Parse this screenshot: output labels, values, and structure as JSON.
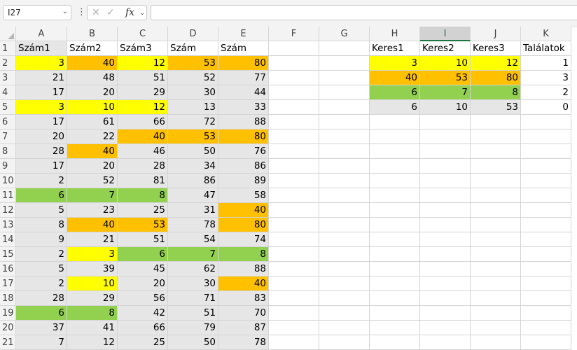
{
  "namebox": {
    "value": "I27",
    "dropdown_icon": "chevron-down-icon"
  },
  "formula_bar": {
    "more_icon": "vertical-dots-icon",
    "cancel_icon": "x-icon",
    "enter_icon": "check-icon",
    "fx_label": "fx",
    "fx_dropdown_icon": "chevron-down-icon",
    "value": ""
  },
  "active_column": "I",
  "colors": {
    "yellow": "#ffff00",
    "orange": "#ffc000",
    "green": "#92d050",
    "gray": "#e7e6e6",
    "white": "#ffffff"
  },
  "columns": [
    "A",
    "B",
    "C",
    "D",
    "E",
    "F",
    "G",
    "H",
    "I",
    "J",
    "K"
  ],
  "rows": [
    {
      "num": "1",
      "cells": [
        {
          "v": "Szám1",
          "f": "gray",
          "t": "txt"
        },
        {
          "v": "Szám2",
          "f": "white",
          "t": "txt"
        },
        {
          "v": "Szám3",
          "f": "white",
          "t": "txt"
        },
        {
          "v": "Szám",
          "f": "white",
          "t": "txt"
        },
        {
          "v": "Szám",
          "f": "white",
          "t": "txt"
        },
        {
          "v": "",
          "f": "white"
        },
        {
          "v": "",
          "f": "white"
        },
        {
          "v": "Keres1",
          "f": "white",
          "t": "txt"
        },
        {
          "v": "Keres2",
          "f": "white",
          "t": "txt"
        },
        {
          "v": "Keres3",
          "f": "white",
          "t": "txt"
        },
        {
          "v": "Találatok",
          "f": "white",
          "t": "txt"
        }
      ]
    },
    {
      "num": "2",
      "cells": [
        {
          "v": "3",
          "f": "yellow"
        },
        {
          "v": "40",
          "f": "orange"
        },
        {
          "v": "12",
          "f": "yellow"
        },
        {
          "v": "53",
          "f": "orange"
        },
        {
          "v": "80",
          "f": "orange"
        },
        {
          "v": "",
          "f": "white"
        },
        {
          "v": "",
          "f": "white"
        },
        {
          "v": "3",
          "f": "yellow"
        },
        {
          "v": "10",
          "f": "yellow"
        },
        {
          "v": "12",
          "f": "yellow"
        },
        {
          "v": "1",
          "f": "white"
        }
      ]
    },
    {
      "num": "3",
      "cells": [
        {
          "v": "21",
          "f": "gray"
        },
        {
          "v": "48",
          "f": "gray"
        },
        {
          "v": "51",
          "f": "gray"
        },
        {
          "v": "52",
          "f": "gray"
        },
        {
          "v": "77",
          "f": "gray"
        },
        {
          "v": "",
          "f": "white"
        },
        {
          "v": "",
          "f": "white"
        },
        {
          "v": "40",
          "f": "orange"
        },
        {
          "v": "53",
          "f": "orange"
        },
        {
          "v": "80",
          "f": "orange"
        },
        {
          "v": "3",
          "f": "white"
        }
      ]
    },
    {
      "num": "4",
      "cells": [
        {
          "v": "17",
          "f": "gray"
        },
        {
          "v": "20",
          "f": "gray"
        },
        {
          "v": "29",
          "f": "gray"
        },
        {
          "v": "30",
          "f": "gray"
        },
        {
          "v": "44",
          "f": "gray"
        },
        {
          "v": "",
          "f": "white"
        },
        {
          "v": "",
          "f": "white"
        },
        {
          "v": "6",
          "f": "green"
        },
        {
          "v": "7",
          "f": "green"
        },
        {
          "v": "8",
          "f": "green"
        },
        {
          "v": "2",
          "f": "white"
        }
      ]
    },
    {
      "num": "5",
      "cells": [
        {
          "v": "3",
          "f": "yellow"
        },
        {
          "v": "10",
          "f": "yellow"
        },
        {
          "v": "12",
          "f": "yellow"
        },
        {
          "v": "13",
          "f": "gray"
        },
        {
          "v": "33",
          "f": "gray"
        },
        {
          "v": "",
          "f": "white"
        },
        {
          "v": "",
          "f": "white"
        },
        {
          "v": "6",
          "f": "gray"
        },
        {
          "v": "10",
          "f": "gray"
        },
        {
          "v": "53",
          "f": "gray"
        },
        {
          "v": "0",
          "f": "white"
        }
      ]
    },
    {
      "num": "6",
      "cells": [
        {
          "v": "17",
          "f": "gray"
        },
        {
          "v": "61",
          "f": "gray"
        },
        {
          "v": "66",
          "f": "gray"
        },
        {
          "v": "72",
          "f": "gray"
        },
        {
          "v": "88",
          "f": "gray"
        }
      ]
    },
    {
      "num": "7",
      "cells": [
        {
          "v": "20",
          "f": "gray"
        },
        {
          "v": "22",
          "f": "gray"
        },
        {
          "v": "40",
          "f": "orange"
        },
        {
          "v": "53",
          "f": "orange"
        },
        {
          "v": "80",
          "f": "orange"
        }
      ]
    },
    {
      "num": "8",
      "cells": [
        {
          "v": "28",
          "f": "gray"
        },
        {
          "v": "40",
          "f": "orange"
        },
        {
          "v": "46",
          "f": "gray"
        },
        {
          "v": "50",
          "f": "gray"
        },
        {
          "v": "76",
          "f": "gray"
        }
      ]
    },
    {
      "num": "9",
      "cells": [
        {
          "v": "17",
          "f": "gray"
        },
        {
          "v": "20",
          "f": "gray"
        },
        {
          "v": "28",
          "f": "gray"
        },
        {
          "v": "34",
          "f": "gray"
        },
        {
          "v": "86",
          "f": "gray"
        }
      ]
    },
    {
      "num": "10",
      "cells": [
        {
          "v": "2",
          "f": "gray"
        },
        {
          "v": "52",
          "f": "gray"
        },
        {
          "v": "81",
          "f": "gray"
        },
        {
          "v": "86",
          "f": "gray"
        },
        {
          "v": "89",
          "f": "gray"
        }
      ]
    },
    {
      "num": "11",
      "cells": [
        {
          "v": "6",
          "f": "green"
        },
        {
          "v": "7",
          "f": "green"
        },
        {
          "v": "8",
          "f": "green"
        },
        {
          "v": "47",
          "f": "gray"
        },
        {
          "v": "58",
          "f": "gray"
        }
      ]
    },
    {
      "num": "12",
      "cells": [
        {
          "v": "5",
          "f": "gray"
        },
        {
          "v": "23",
          "f": "gray"
        },
        {
          "v": "25",
          "f": "gray"
        },
        {
          "v": "31",
          "f": "gray"
        },
        {
          "v": "40",
          "f": "orange"
        }
      ]
    },
    {
      "num": "13",
      "cells": [
        {
          "v": "8",
          "f": "gray"
        },
        {
          "v": "40",
          "f": "orange"
        },
        {
          "v": "53",
          "f": "orange"
        },
        {
          "v": "78",
          "f": "gray"
        },
        {
          "v": "80",
          "f": "orange"
        }
      ]
    },
    {
      "num": "14",
      "cells": [
        {
          "v": "9",
          "f": "gray"
        },
        {
          "v": "21",
          "f": "gray"
        },
        {
          "v": "51",
          "f": "gray"
        },
        {
          "v": "54",
          "f": "gray"
        },
        {
          "v": "74",
          "f": "gray"
        }
      ]
    },
    {
      "num": "15",
      "cells": [
        {
          "v": "2",
          "f": "gray"
        },
        {
          "v": "3",
          "f": "yellow"
        },
        {
          "v": "6",
          "f": "green"
        },
        {
          "v": "7",
          "f": "green"
        },
        {
          "v": "8",
          "f": "green"
        }
      ]
    },
    {
      "num": "16",
      "cells": [
        {
          "v": "5",
          "f": "gray"
        },
        {
          "v": "39",
          "f": "gray"
        },
        {
          "v": "45",
          "f": "gray"
        },
        {
          "v": "62",
          "f": "gray"
        },
        {
          "v": "88",
          "f": "gray"
        }
      ]
    },
    {
      "num": "17",
      "cells": [
        {
          "v": "2",
          "f": "gray"
        },
        {
          "v": "10",
          "f": "yellow"
        },
        {
          "v": "20",
          "f": "gray"
        },
        {
          "v": "30",
          "f": "gray"
        },
        {
          "v": "40",
          "f": "orange"
        }
      ]
    },
    {
      "num": "18",
      "cells": [
        {
          "v": "28",
          "f": "gray"
        },
        {
          "v": "29",
          "f": "gray"
        },
        {
          "v": "56",
          "f": "gray"
        },
        {
          "v": "71",
          "f": "gray"
        },
        {
          "v": "83",
          "f": "gray"
        }
      ]
    },
    {
      "num": "19",
      "cells": [
        {
          "v": "6",
          "f": "green"
        },
        {
          "v": "8",
          "f": "green"
        },
        {
          "v": "42",
          "f": "gray"
        },
        {
          "v": "51",
          "f": "gray"
        },
        {
          "v": "70",
          "f": "gray"
        }
      ]
    },
    {
      "num": "20",
      "cells": [
        {
          "v": "37",
          "f": "gray"
        },
        {
          "v": "41",
          "f": "gray"
        },
        {
          "v": "66",
          "f": "gray"
        },
        {
          "v": "79",
          "f": "gray"
        },
        {
          "v": "87",
          "f": "gray"
        }
      ]
    },
    {
      "num": "21",
      "cells": [
        {
          "v": "7",
          "f": "gray"
        },
        {
          "v": "12",
          "f": "gray"
        },
        {
          "v": "25",
          "f": "gray"
        },
        {
          "v": "50",
          "f": "gray"
        },
        {
          "v": "78",
          "f": "gray"
        }
      ]
    }
  ]
}
